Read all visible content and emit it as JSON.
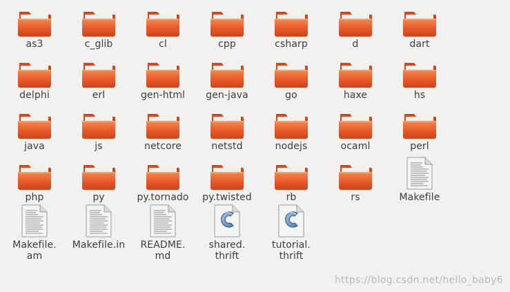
{
  "items": [
    {
      "name": "as3",
      "type": "folder"
    },
    {
      "name": "c_glib",
      "type": "folder"
    },
    {
      "name": "cl",
      "type": "folder"
    },
    {
      "name": "cpp",
      "type": "folder"
    },
    {
      "name": "csharp",
      "type": "folder"
    },
    {
      "name": "d",
      "type": "folder"
    },
    {
      "name": "dart",
      "type": "folder"
    },
    {
      "name": "delphi",
      "type": "folder"
    },
    {
      "name": "erl",
      "type": "folder"
    },
    {
      "name": "gen-html",
      "type": "folder"
    },
    {
      "name": "gen-java",
      "type": "folder"
    },
    {
      "name": "go",
      "type": "folder"
    },
    {
      "name": "haxe",
      "type": "folder"
    },
    {
      "name": "hs",
      "type": "folder"
    },
    {
      "name": "java",
      "type": "folder"
    },
    {
      "name": "js",
      "type": "folder"
    },
    {
      "name": "netcore",
      "type": "folder"
    },
    {
      "name": "netstd",
      "type": "folder"
    },
    {
      "name": "nodejs",
      "type": "folder"
    },
    {
      "name": "ocaml",
      "type": "folder"
    },
    {
      "name": "perl",
      "type": "folder"
    },
    {
      "name": "php",
      "type": "folder"
    },
    {
      "name": "py",
      "type": "folder"
    },
    {
      "name": "py.tornado",
      "type": "folder"
    },
    {
      "name": "py.twisted",
      "type": "folder"
    },
    {
      "name": "rb",
      "type": "folder"
    },
    {
      "name": "rs",
      "type": "folder"
    },
    {
      "name": "Makefile",
      "type": "text-file"
    },
    {
      "name": "Makefile.\nam",
      "type": "text-file"
    },
    {
      "name": "Makefile.in",
      "type": "text-file"
    },
    {
      "name": "README.\nmd",
      "type": "text-file"
    },
    {
      "name": "shared.\nthrift",
      "type": "c-source-file"
    },
    {
      "name": "tutorial.\nthrift",
      "type": "c-source-file"
    }
  ],
  "icons": {
    "folder": "folder-icon",
    "text-file": "text-file-icon",
    "c-source-file": "c-source-file-icon"
  },
  "colors": {
    "background": "#f2f1f0",
    "folder_body": "#e8582a",
    "folder_light": "#f7a06a",
    "label": "#3c3c3c"
  },
  "watermark": "https://blog.csdn.net/hello_baby6"
}
